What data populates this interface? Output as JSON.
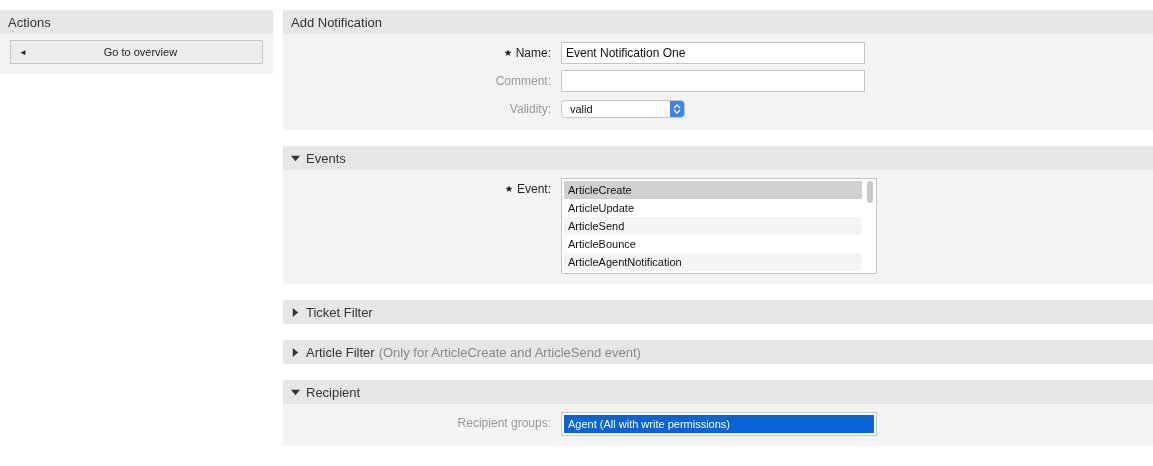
{
  "sidebar": {
    "title": "Actions",
    "buttons": [
      {
        "label": "Go to overview",
        "icon": "◄"
      }
    ]
  },
  "sections": [
    {
      "title": "Add Notification",
      "collapsible": false,
      "expanded": true,
      "fields": [
        {
          "kind": "text",
          "label": "Name:",
          "required": true,
          "value": "Event Notification One"
        },
        {
          "kind": "text",
          "label": "Comment:",
          "required": false
        },
        {
          "kind": "select",
          "label": "Validity:",
          "required": false,
          "value": "valid"
        }
      ]
    },
    {
      "title": "Events",
      "collapsible": true,
      "expanded": true,
      "fields": [
        {
          "kind": "listbox",
          "label": "Event:",
          "required": true,
          "focused": false,
          "options": [
            {
              "label": "ArticleCreate",
              "selected": true
            },
            {
              "label": "ArticleUpdate",
              "selected": false
            },
            {
              "label": "ArticleSend",
              "selected": false
            },
            {
              "label": "ArticleBounce",
              "selected": false
            },
            {
              "label": "ArticleAgentNotification",
              "selected": false
            }
          ]
        }
      ]
    },
    {
      "title": "Ticket Filter",
      "collapsible": true,
      "expanded": false
    },
    {
      "title": "Article Filter",
      "subtitle": "(Only for ArticleCreate and ArticleSend event)",
      "collapsible": true,
      "expanded": false
    },
    {
      "title": "Recipient",
      "collapsible": true,
      "expanded": true,
      "fields": [
        {
          "kind": "listbox",
          "label": "Recipient groups:",
          "required": false,
          "focused": true,
          "options": [
            {
              "label": "Agent (All with write permissions)",
              "selected": true
            }
          ]
        }
      ]
    }
  ]
}
